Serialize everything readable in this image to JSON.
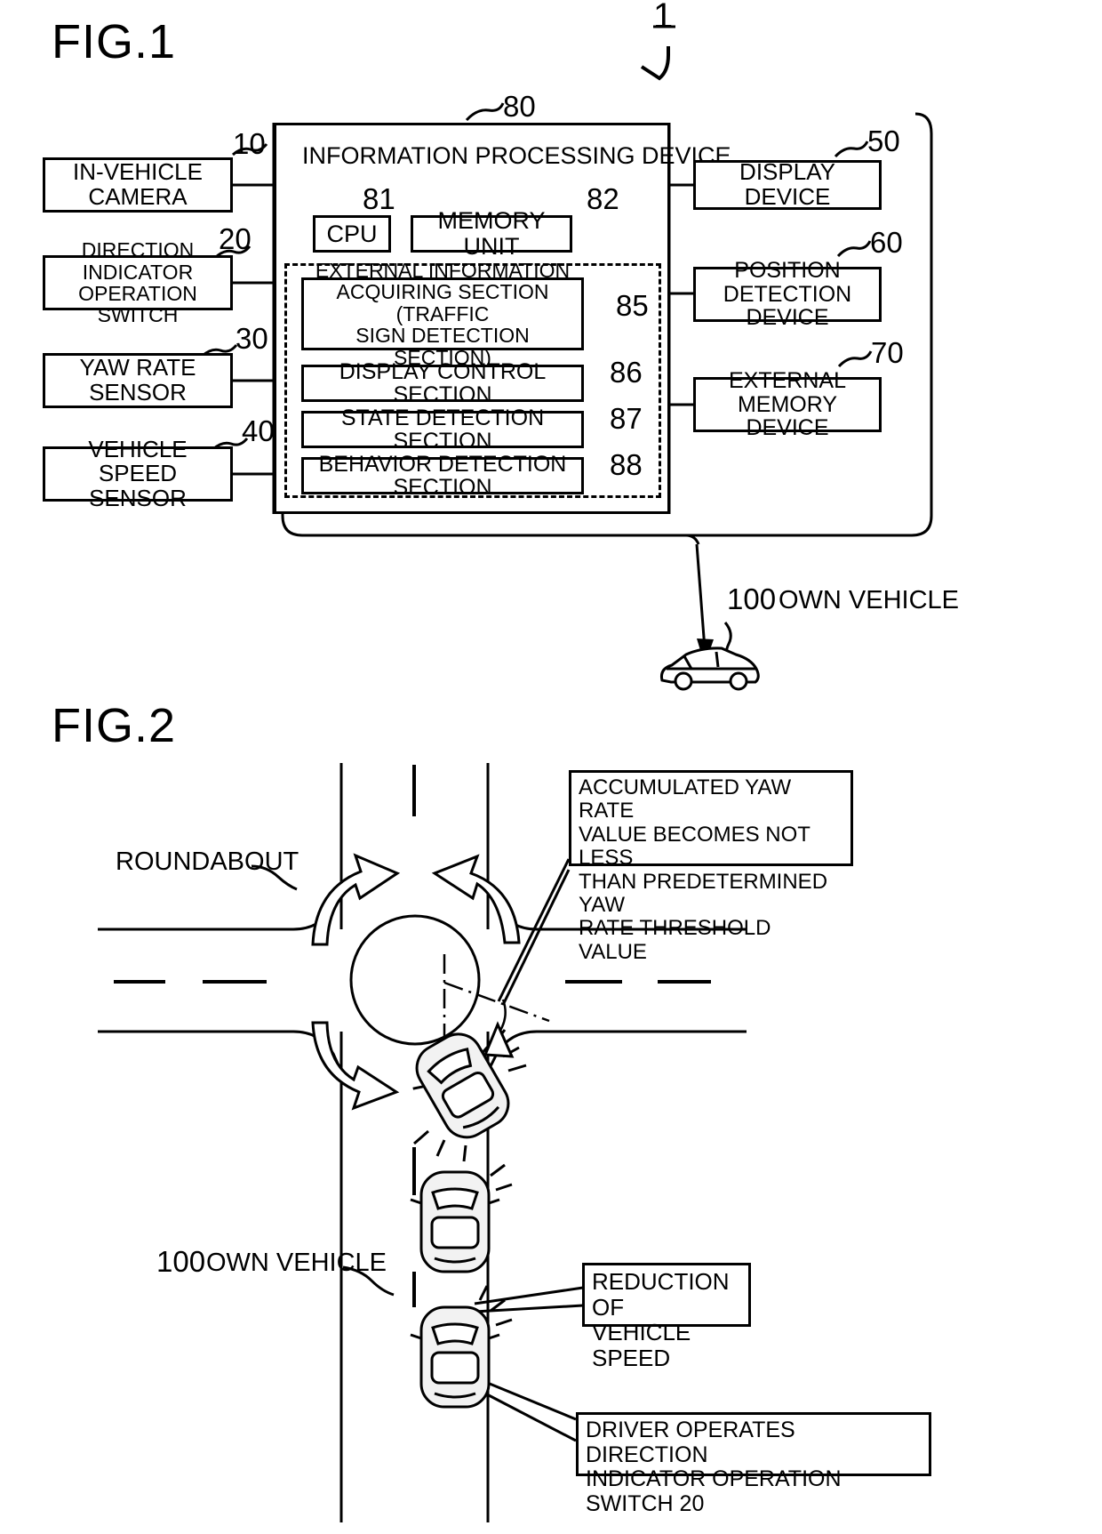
{
  "figures": {
    "fig1": {
      "title": "FIG.1",
      "system_ref": "1",
      "left_blocks": [
        {
          "ref": "10",
          "label": "IN-VEHICLE\nCAMERA"
        },
        {
          "ref": "20",
          "label": "DIRECTION INDICATOR\nOPERATION SWITCH"
        },
        {
          "ref": "30",
          "label": "YAW RATE\nSENSOR"
        },
        {
          "ref": "40",
          "label": "VEHICLE SPEED\nSENSOR"
        }
      ],
      "right_blocks": [
        {
          "ref": "50",
          "label": "DISPLAY DEVICE"
        },
        {
          "ref": "60",
          "label": "POSITION\nDETECTION DEVICE"
        },
        {
          "ref": "70",
          "label": "EXTERNAL\nMEMORY DEVICE"
        }
      ],
      "center": {
        "ref": "80",
        "title": "INFORMATION PROCESSING DEVICE",
        "cpu": {
          "ref": "81",
          "label": "CPU"
        },
        "memory": {
          "ref": "82",
          "label": "MEMORY UNIT"
        },
        "sections": [
          {
            "ref": "85",
            "label": "EXTERNAL INFORMATION\nACQUIRING SECTION (TRAFFIC\nSIGN DETECTION SECTION)"
          },
          {
            "ref": "86",
            "label": "DISPLAY CONTROL SECTION"
          },
          {
            "ref": "87",
            "label": "STATE DETECTION SECTION"
          },
          {
            "ref": "88",
            "label": "BEHAVIOR DETECTION SECTION"
          }
        ]
      },
      "vehicle": {
        "ref": "100",
        "label": "OWN VEHICLE"
      }
    },
    "fig2": {
      "title": "FIG.2",
      "roundabout_label": "ROUNDABOUT",
      "callout_yaw": "ACCUMULATED YAW RATE\nVALUE BECOMES NOT LESS\nTHAN PREDETERMINED YAW\nRATE THRESHOLD VALUE",
      "callout_speed": "REDUCTION OF\nVEHICLE SPEED",
      "callout_driver": "DRIVER OPERATES DIRECTION\nINDICATOR OPERATION SWITCH 20",
      "vehicle": {
        "ref": "100",
        "label": "OWN VEHICLE"
      }
    }
  },
  "colors": {
    "ink": "#000000",
    "paper": "#ffffff",
    "car_fill": "#f2f2f2"
  }
}
